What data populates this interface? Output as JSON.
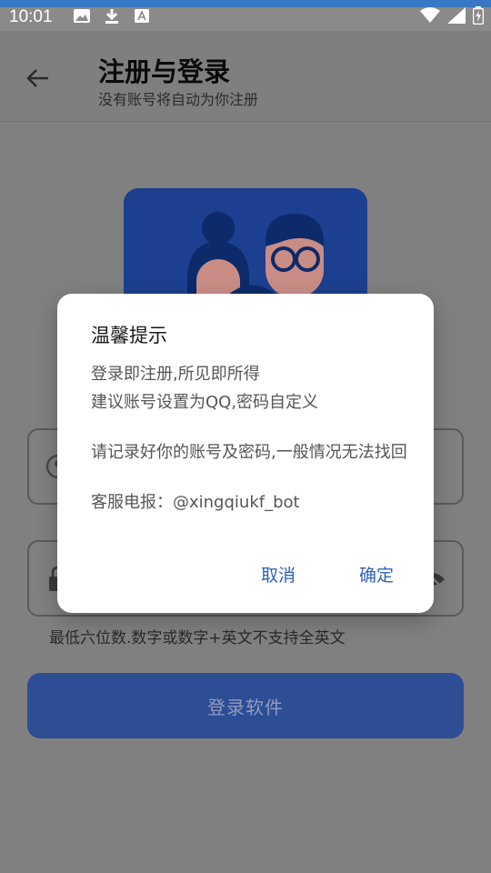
{
  "status_bar": {
    "time": "10:01",
    "icons": [
      "image-icon",
      "download-icon",
      "font-a-icon",
      "wifi-icon",
      "signal-icon",
      "battery-icon"
    ]
  },
  "app_bar": {
    "title": "注册与登录",
    "subtitle": "没有账号将自动为你注册"
  },
  "login": {
    "hint": "最低六位数.数字或数字+英文不支持全英文",
    "button_label": "登录软件"
  },
  "dialog": {
    "title": "温馨提示",
    "line1": "登录即注册,所见即所得",
    "line2": "建议账号设置为QQ,密码自定义",
    "line3": "请记录好你的账号及密码,一般情况无法找回",
    "line4": "客服电报：@xingqiukf_bot",
    "cancel_label": "取消",
    "ok_label": "确定"
  },
  "colors": {
    "accent": "#2f62b8",
    "illustration_bg": "#1c3f8f"
  }
}
